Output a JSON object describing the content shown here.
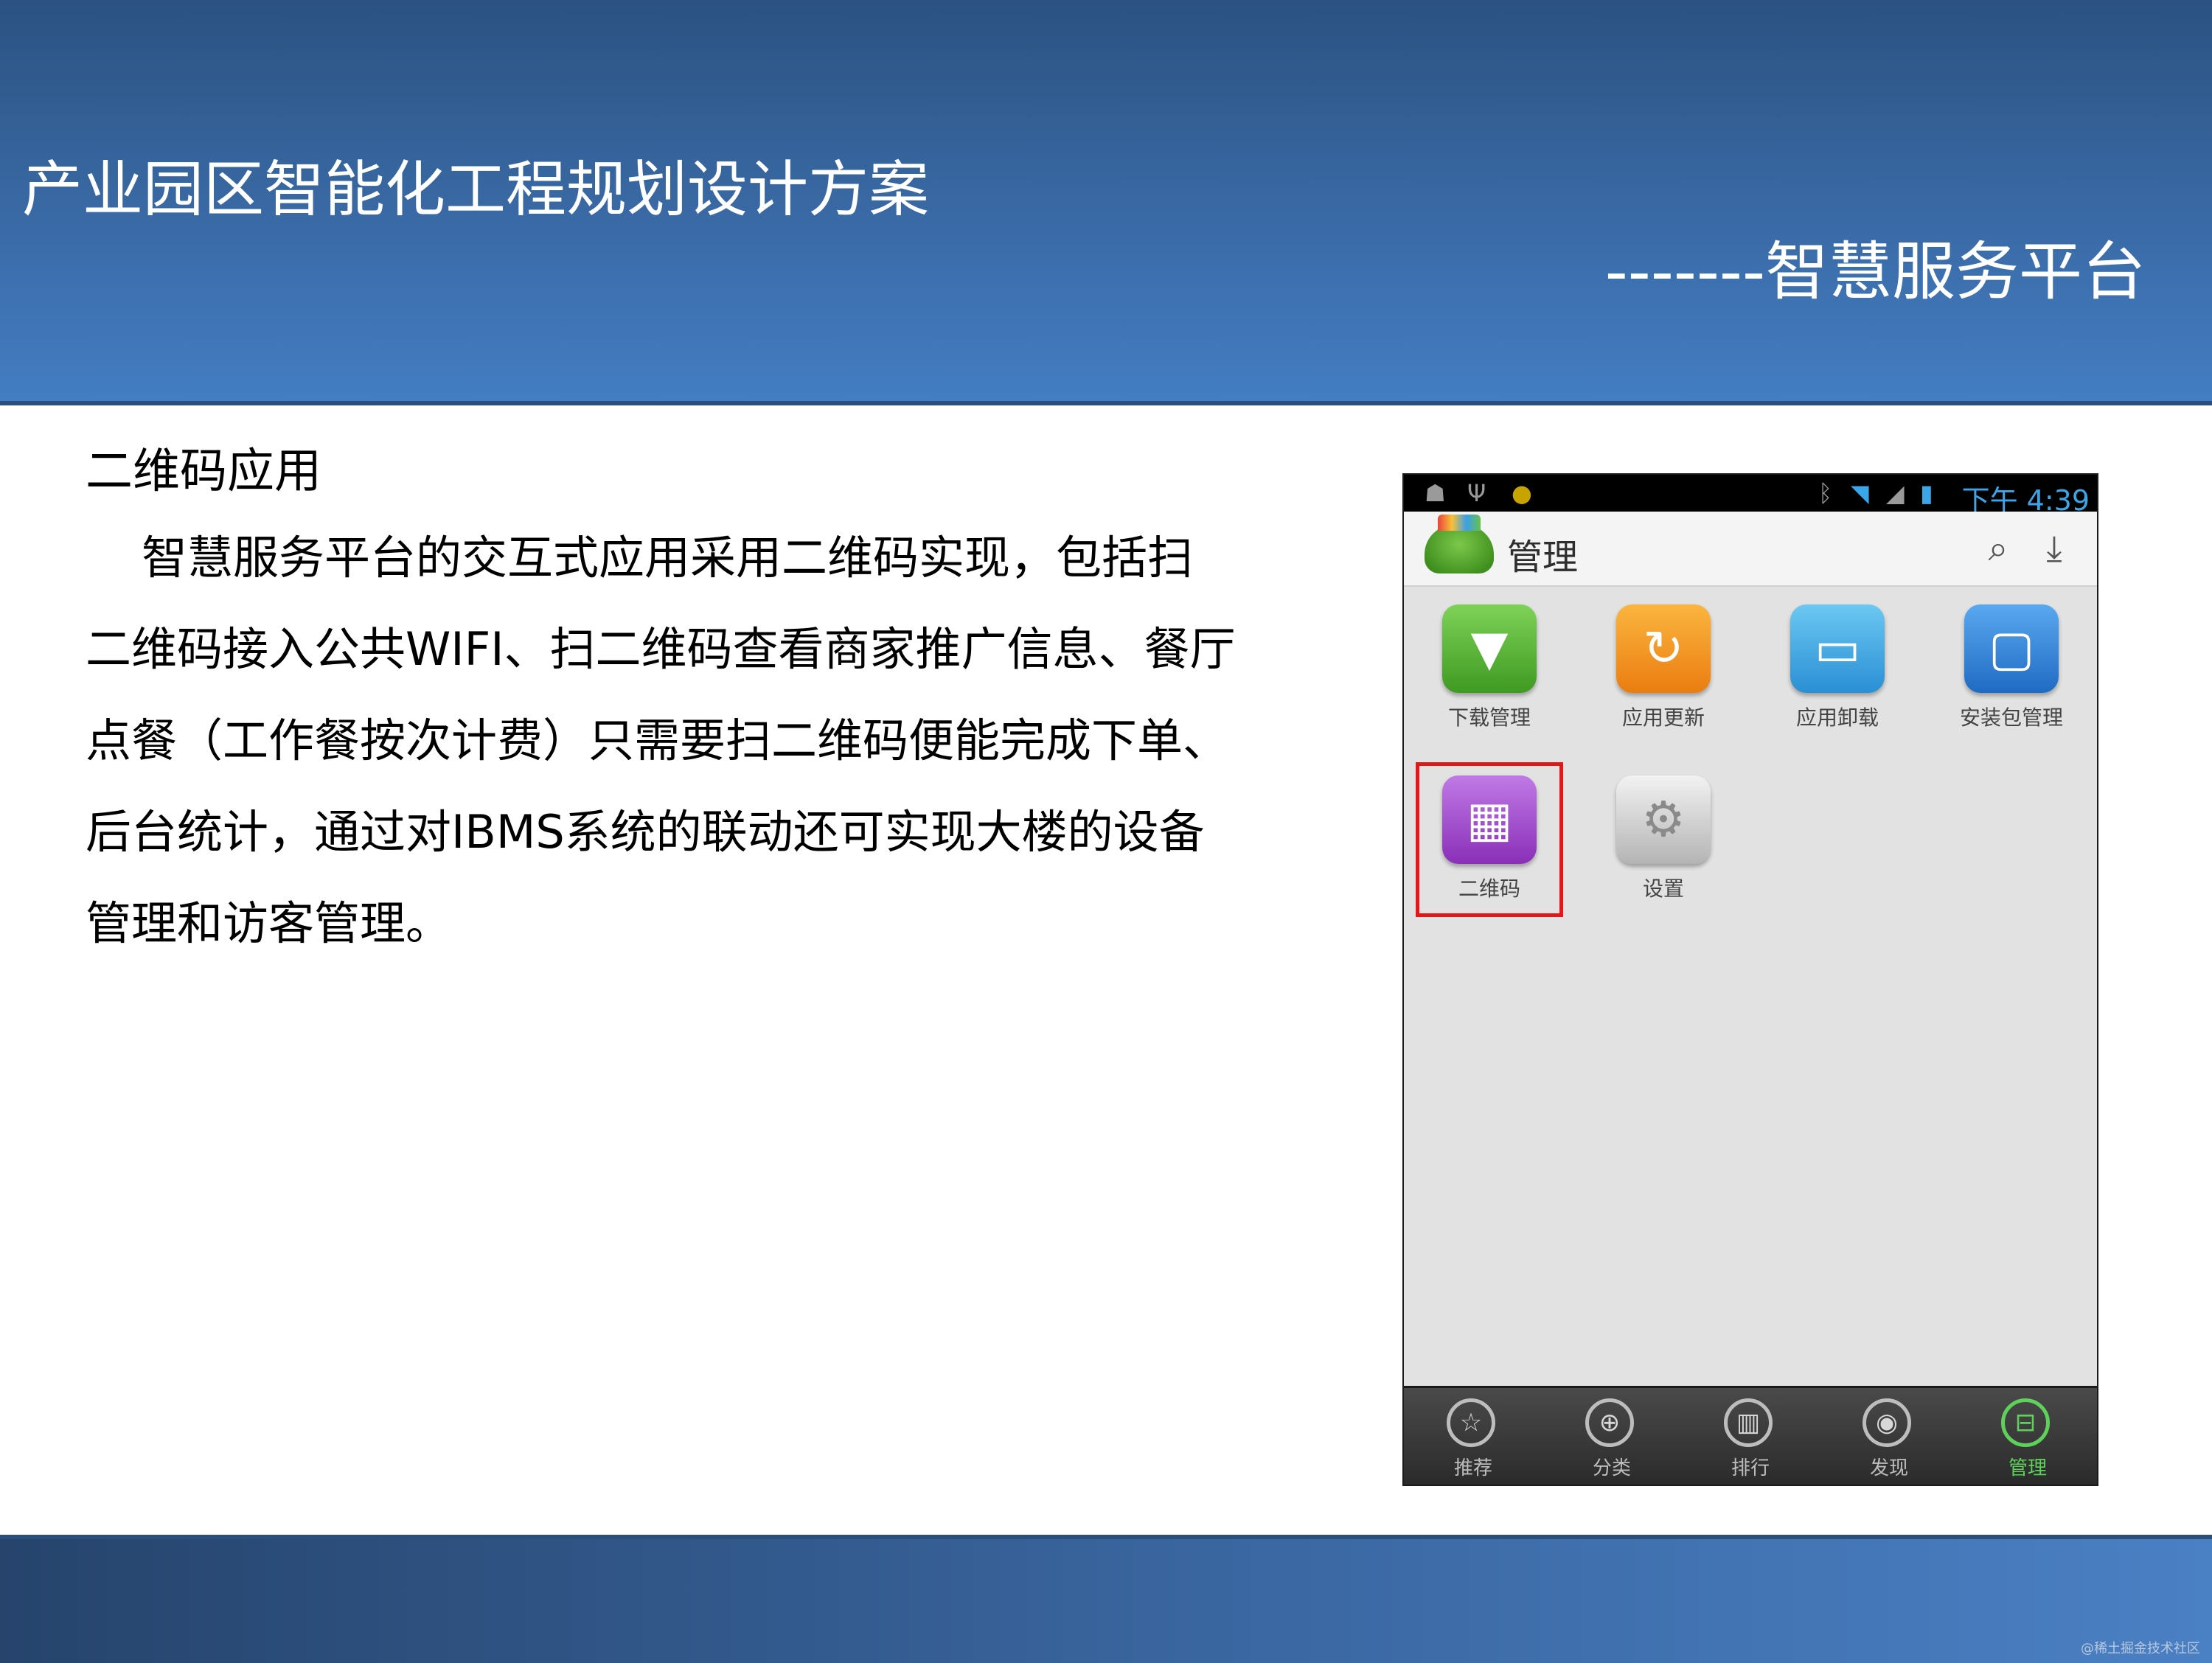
{
  "header": {
    "title": "产业园区智能化工程规划设计方案",
    "subtitle": "-------智慧服务平台"
  },
  "content": {
    "section_heading": "二维码应用",
    "paragraph": "智慧服务平台的交互式应用采用二维码实现，包括扫二维码接入公共WIFI、扫二维码查看商家推广信息、餐厅点餐（工作餐按次计费）只需要扫二维码便能完成下单、后台统计，通过对IBMS系统的联动还可实现大楼的设备管理和访客管理。"
  },
  "phone": {
    "status_bar": {
      "time": "下午 4:39",
      "icons": [
        "android-debug-icon",
        "usb-icon",
        "notification-icon",
        "bluetooth-icon",
        "wifi-icon",
        "signal-icon",
        "battery-icon"
      ]
    },
    "app_bar": {
      "title": "管理",
      "actions": [
        "search-icon",
        "download-icon"
      ]
    },
    "apps": [
      {
        "label": "下载管理",
        "icon": "download-arrow-icon",
        "color": "#56b53a"
      },
      {
        "label": "应用更新",
        "icon": "update-icon",
        "color": "#f39a1e"
      },
      {
        "label": "应用卸载",
        "icon": "uninstall-icon",
        "color": "#3aa6e0"
      },
      {
        "label": "安装包管理",
        "icon": "package-icon",
        "color": "#2f7fd6"
      },
      {
        "label": "二维码",
        "icon": "qrcode-icon",
        "color": "#9a3fc6",
        "highlighted": true
      },
      {
        "label": "设置",
        "icon": "gear-icon",
        "color": "#c8c8c8"
      }
    ],
    "bottom_nav": [
      {
        "label": "推荐",
        "icon": "star-icon"
      },
      {
        "label": "分类",
        "icon": "category-icon"
      },
      {
        "label": "排行",
        "icon": "ranking-icon"
      },
      {
        "label": "发现",
        "icon": "eye-icon"
      },
      {
        "label": "管理",
        "icon": "manage-icon",
        "active": true
      }
    ]
  },
  "footer": {
    "watermark": "@稀土掘金技术社区"
  }
}
